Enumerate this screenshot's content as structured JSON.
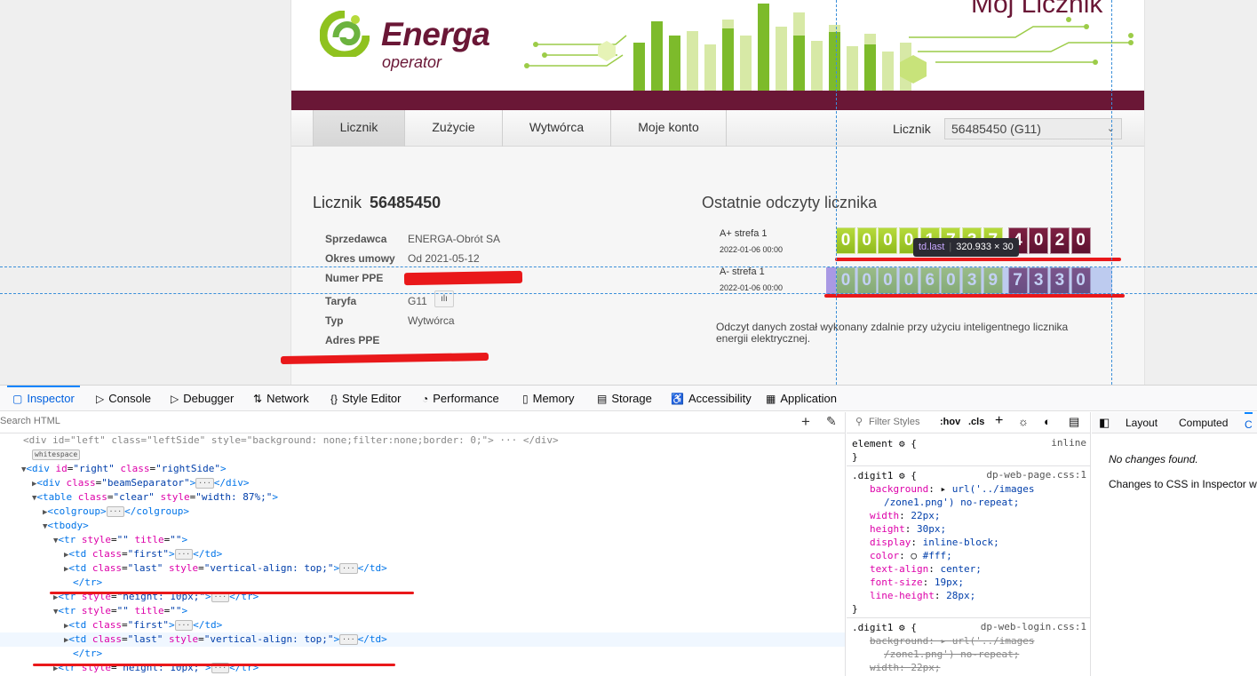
{
  "site": {
    "brand_name": "Energa",
    "brand_sub": "operator",
    "app_title": "Mój Licznik",
    "nav_tabs": [
      "Licznik",
      "Zużycie",
      "Wytwórca",
      "Moje konto"
    ],
    "active_tab": "Licznik",
    "meter_label": "Licznik",
    "meter_select": "56485450 (G11)"
  },
  "meter_info": {
    "heading_prefix": "Licznik",
    "heading_number": "56485450",
    "rows": [
      {
        "label": "Sprzedawca",
        "value": "ENERGA-Obrót SA"
      },
      {
        "label": "Okres umowy",
        "value": "Od 2021-05-12"
      },
      {
        "label": "Numer PPE",
        "value": ""
      },
      {
        "label": "Taryfa",
        "value": "G11"
      },
      {
        "label": "Typ",
        "value": "Wytwórca"
      },
      {
        "label": "Adres PPE",
        "value": ""
      }
    ]
  },
  "readings": {
    "heading": "Ostatnie odczyty licznika",
    "zones": [
      {
        "label": "A+ strefa 1",
        "date": "2022-01-06 00:00",
        "int_digits": [
          "0",
          "0",
          "0",
          "0",
          "1",
          "7",
          "3",
          "7"
        ],
        "dec_digits": [
          "4",
          "0",
          "2",
          "0"
        ]
      },
      {
        "label": "A- strefa 1",
        "date": "2022-01-06 00:00",
        "int_digits": [
          "0",
          "0",
          "0",
          "0",
          "6",
          "0",
          "3",
          "9"
        ],
        "dec_digits": [
          "7",
          "3",
          "3",
          "0"
        ]
      }
    ],
    "note": "Odczyt danych został wykonany zdalnie przy użyciu inteligentnego licznika energii elektrycznej."
  },
  "highlight": {
    "selector": "td.last",
    "size": "320.933 × 30"
  },
  "devtools": {
    "tabs": [
      {
        "label": "Inspector",
        "icon": "▢"
      },
      {
        "label": "Console",
        "icon": "▷"
      },
      {
        "label": "Debugger",
        "icon": "▷"
      },
      {
        "label": "Network",
        "icon": "⇅"
      },
      {
        "label": "Style Editor",
        "icon": "{}"
      },
      {
        "label": "Performance",
        "icon": "◔"
      },
      {
        "label": "Memory",
        "icon": "▯"
      },
      {
        "label": "Storage",
        "icon": "▤"
      },
      {
        "label": "Accessibility",
        "icon": "♿"
      },
      {
        "label": "Application",
        "icon": "▦"
      }
    ],
    "search_placeholder": "Search HTML",
    "filter_placeholder": "Filter Styles",
    "hov": ":hov",
    "cls": ".cls",
    "side_tabs": [
      "Layout",
      "Computed",
      "C"
    ],
    "no_changes": "No changes found.",
    "changes_hint": "Changes to CSS in Inspector w",
    "whitespace_badge": "whitespace",
    "element_rule": {
      "selector": "element",
      "source": "inline"
    },
    "rule1": {
      "selector": ".digit1",
      "source": "dp-web-page.css:1"
    },
    "rule2": {
      "selector": ".digit1",
      "source": "dp-web-login.css:1"
    },
    "css_props": [
      {
        "name": "background",
        "value": "url('../images"
      },
      {
        "name": "",
        "value": "/zone1.png') no-repeat;"
      },
      {
        "name": "width",
        "value": "22px;"
      },
      {
        "name": "height",
        "value": "30px;"
      },
      {
        "name": "display",
        "value": "inline-block;"
      },
      {
        "name": "color",
        "value": "#fff;"
      },
      {
        "name": "text-align",
        "value": "center;"
      },
      {
        "name": "font-size",
        "value": "19px;"
      },
      {
        "name": "line-height",
        "value": "28px;"
      }
    ]
  }
}
